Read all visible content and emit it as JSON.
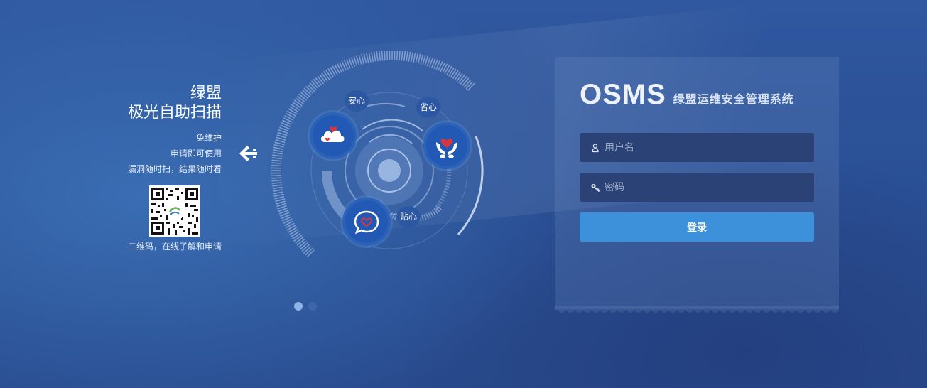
{
  "promo": {
    "title_line1": "绿盟",
    "title_line2": "极光自助扫描",
    "features": [
      "免维护",
      "申请即可使用",
      "漏洞随时扫，结果随时看"
    ],
    "qr_caption": "二维码，在线了解和申请"
  },
  "illustration": {
    "tags": {
      "anxin": "安心",
      "shengxin": "省心",
      "tiexin": "贴心"
    },
    "icons": [
      "cloud-heart-icon",
      "hands-heart-icon",
      "chat-heart-icon"
    ],
    "carousel": {
      "slides": 2,
      "active": 1
    }
  },
  "login": {
    "brand_logo": "OSMS",
    "brand_subtitle": "绿盟运维安全管理系统",
    "username": {
      "placeholder": "用户名",
      "value": ""
    },
    "password": {
      "placeholder": "密码",
      "value": ""
    },
    "submit_label": "登录"
  },
  "colors": {
    "background": "#2b519a",
    "field_bg": "#2b4277",
    "button": "#3d91db",
    "heart": "#d9353f"
  }
}
